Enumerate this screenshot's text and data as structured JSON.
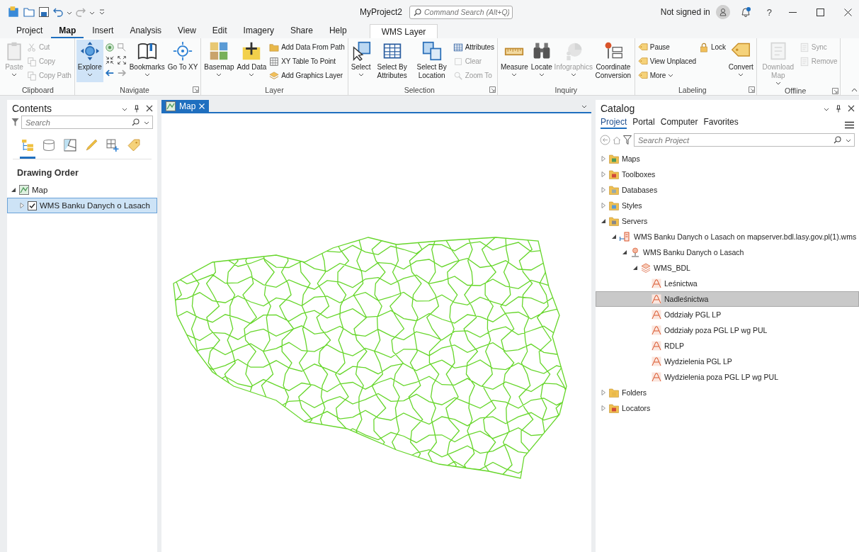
{
  "title_bar": {
    "title": "MyProject2",
    "command_search": {
      "placeholder": "Command Search (Alt+Q)"
    },
    "account": "Not signed in",
    "help": "?"
  },
  "ribbon_tabs": [
    {
      "label": "Project",
      "selected": false
    },
    {
      "label": "Map",
      "selected": true
    },
    {
      "label": "Insert",
      "selected": false
    },
    {
      "label": "Analysis",
      "selected": false
    },
    {
      "label": "View",
      "selected": false
    },
    {
      "label": "Edit",
      "selected": false
    },
    {
      "label": "Imagery",
      "selected": false
    },
    {
      "label": "Share",
      "selected": false
    },
    {
      "label": "Help",
      "selected": false
    }
  ],
  "contextual_tab": {
    "label": "WMS Layer"
  },
  "ribbon_groups": [
    {
      "label": "Clipboard",
      "launcher": false,
      "items": [
        {
          "kind": "large",
          "label": "Paste",
          "disabled": true,
          "active": false,
          "dropdown": true
        },
        {
          "kind": "column",
          "buttons": [
            {
              "label": "Cut",
              "disabled": true,
              "dropdown": false
            },
            {
              "label": "Copy",
              "disabled": true,
              "dropdown": false
            },
            {
              "label": "Copy Path",
              "disabled": true,
              "dropdown": false
            }
          ]
        }
      ]
    },
    {
      "label": "Navigate",
      "launcher": true,
      "items": [
        {
          "kind": "large",
          "label": "Explore",
          "disabled": false,
          "active": true,
          "dropdown": true
        },
        {
          "kind": "navgrid"
        },
        {
          "kind": "large",
          "label": "Bookmarks",
          "disabled": false,
          "active": false,
          "dropdown": true
        },
        {
          "kind": "large",
          "label": "Go To XY",
          "disabled": false,
          "active": false,
          "dropdown": false
        }
      ]
    },
    {
      "label": "Layer",
      "launcher": false,
      "items": [
        {
          "kind": "large",
          "label": "Basemap",
          "disabled": false,
          "active": false,
          "dropdown": true
        },
        {
          "kind": "large",
          "label": "Add Data",
          "disabled": false,
          "active": false,
          "dropdown": true
        },
        {
          "kind": "column",
          "buttons": [
            {
              "label": "Add Data From Path",
              "disabled": false,
              "dropdown": false
            },
            {
              "label": "XY Table To Point",
              "disabled": false,
              "dropdown": false
            },
            {
              "label": "Add Graphics Layer",
              "disabled": false,
              "dropdown": false
            }
          ]
        }
      ]
    },
    {
      "label": "Selection",
      "launcher": true,
      "items": [
        {
          "kind": "large",
          "label": "Select",
          "disabled": false,
          "active": false,
          "dropdown": true
        },
        {
          "kind": "large",
          "label": "Select By Attributes",
          "disabled": false,
          "active": false,
          "dropdown": false
        },
        {
          "kind": "large",
          "label": "Select By Location",
          "disabled": false,
          "active": false,
          "dropdown": false
        },
        {
          "kind": "column",
          "buttons": [
            {
              "label": "Attributes",
              "disabled": false,
              "dropdown": false
            },
            {
              "label": "Clear",
              "disabled": true,
              "dropdown": false
            },
            {
              "label": "Zoom To",
              "disabled": true,
              "dropdown": false
            }
          ]
        }
      ]
    },
    {
      "label": "Inquiry",
      "launcher": false,
      "items": [
        {
          "kind": "large",
          "label": "Measure",
          "disabled": false,
          "active": false,
          "dropdown": true
        },
        {
          "kind": "large",
          "label": "Locate",
          "disabled": false,
          "active": false,
          "dropdown": true
        },
        {
          "kind": "large",
          "label": "Infographics",
          "disabled": true,
          "active": false,
          "dropdown": true
        },
        {
          "kind": "large",
          "label": "Coordinate Conversion",
          "disabled": false,
          "active": false,
          "dropdown": false
        }
      ]
    },
    {
      "label": "Labeling",
      "launcher": true,
      "items": [
        {
          "kind": "column",
          "buttons": [
            {
              "label": "Pause",
              "disabled": false,
              "dropdown": false
            },
            {
              "label": "View Unplaced",
              "disabled": false,
              "dropdown": false
            },
            {
              "label": "More",
              "disabled": false,
              "dropdown": true
            }
          ]
        },
        {
          "kind": "column",
          "buttons": [
            {
              "label": "Lock",
              "disabled": false,
              "dropdown": false
            }
          ]
        },
        {
          "kind": "large",
          "label": "Convert",
          "disabled": false,
          "active": false,
          "dropdown": true
        }
      ]
    },
    {
      "label": "Offline",
      "launcher": true,
      "items": [
        {
          "kind": "large",
          "label": "Download Map",
          "disabled": true,
          "active": false,
          "dropdown": true
        },
        {
          "kind": "column",
          "buttons": [
            {
              "label": "Sync",
              "disabled": true,
              "dropdown": false
            },
            {
              "label": "Remove",
              "disabled": true,
              "dropdown": false
            }
          ]
        }
      ]
    }
  ],
  "contents": {
    "title": "Contents",
    "search": {
      "placeholder": "Search"
    },
    "views": [
      {
        "selected": true
      },
      {
        "selected": false
      },
      {
        "selected": false
      },
      {
        "selected": false
      },
      {
        "selected": false
      },
      {
        "selected": false
      }
    ],
    "heading": "Drawing Order",
    "layers": [
      {
        "kind": "map",
        "label": "Map",
        "expanded": true,
        "selected": false,
        "children": [
          {
            "kind": "layer",
            "label": "WMS Banku Danych o Lasach",
            "expanded": false,
            "checked": true,
            "selected": true
          }
        ]
      }
    ]
  },
  "map_view": {
    "tab": {
      "label": "Map",
      "selected": true
    }
  },
  "catalog": {
    "title": "Catalog",
    "tabs": [
      {
        "label": "Project",
        "selected": true
      },
      {
        "label": "Portal",
        "selected": false
      },
      {
        "label": "Computer",
        "selected": false
      },
      {
        "label": "Favorites",
        "selected": false
      }
    ],
    "search": {
      "placeholder": "Search Project"
    },
    "items": [
      {
        "kind": "maps",
        "label": "Maps",
        "expanded": false,
        "selected": false
      },
      {
        "kind": "toolboxes",
        "label": "Toolboxes",
        "expanded": false,
        "selected": false
      },
      {
        "kind": "databases",
        "label": "Databases",
        "expanded": false,
        "selected": false
      },
      {
        "kind": "styles",
        "label": "Styles",
        "expanded": false,
        "selected": false
      },
      {
        "kind": "servers",
        "label": "Servers",
        "expanded": true,
        "selected": false,
        "children": [
          {
            "kind": "connection",
            "label": "WMS Banku Danych o Lasach on mapserver.bdl.lasy.gov.pl(1).wms",
            "expanded": true,
            "selected": false,
            "children": [
              {
                "kind": "service",
                "label": "WMS Banku Danych o Lasach",
                "expanded": true,
                "selected": false,
                "children": [
                  {
                    "kind": "group",
                    "label": "WMS_BDL",
                    "expanded": true,
                    "selected": false,
                    "children": [
                      {
                        "kind": "layer",
                        "label": "Leśnictwa",
                        "selected": false
                      },
                      {
                        "kind": "layer",
                        "label": "Nadleśnictwa",
                        "selected": true
                      },
                      {
                        "kind": "layer",
                        "label": "Oddziały PGL LP",
                        "selected": false
                      },
                      {
                        "kind": "layer",
                        "label": "Oddziały poza PGL LP wg PUL",
                        "selected": false
                      },
                      {
                        "kind": "layer",
                        "label": "RDLP",
                        "selected": false
                      },
                      {
                        "kind": "layer",
                        "label": "Wydzielenia PGL LP",
                        "selected": false
                      },
                      {
                        "kind": "layer",
                        "label": "Wydzielenia poza PGL LP wg PUL",
                        "selected": false
                      }
                    ]
                  }
                ]
              }
            ]
          }
        ]
      },
      {
        "kind": "folders",
        "label": "Folders",
        "expanded": false,
        "selected": false
      },
      {
        "kind": "locators",
        "label": "Locators",
        "expanded": false,
        "selected": false
      }
    ]
  }
}
